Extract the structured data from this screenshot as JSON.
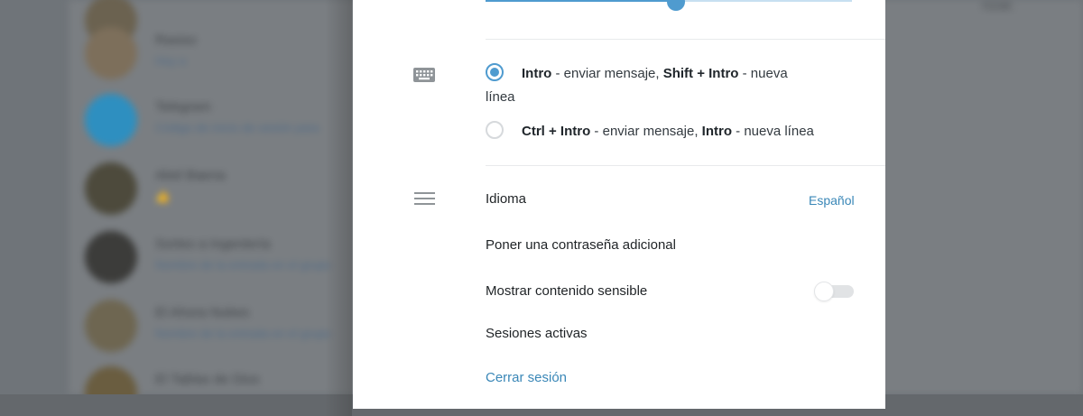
{
  "background": {
    "chats": [
      {
        "name": "Rasiso",
        "preview": "Hoy a"
      },
      {
        "name": "Telegram",
        "preview": "Código de inicio de sesión para"
      },
      {
        "name": "Abel Baena",
        "preview": "👍"
      },
      {
        "name": "Sorteo a Ingeniería",
        "preview": "Nombre de la entrada en el grupo"
      },
      {
        "name": "El Ahora Nubes",
        "preview": "Nombre de la entrada en el grupo"
      },
      {
        "name": "El Tablas de Dios",
        "preview": ""
      }
    ],
    "right_text": "nzar."
  },
  "send_options": [
    {
      "selected": true,
      "key1": "Intro",
      "text1": " - enviar mensaje, ",
      "key2": "Shift + Intro",
      "text2": " - nueva",
      "text3": "línea"
    },
    {
      "selected": false,
      "key1": "Ctrl + Intro",
      "text1": " - enviar mensaje, ",
      "key2": "Intro",
      "text2": " - nueva línea"
    }
  ],
  "settings": {
    "language_label": "Idioma",
    "language_value": "Español",
    "password_label": "Poner una contraseña adicional",
    "sensitive_label": "Mostrar contenido sensible",
    "sensitive_enabled": false,
    "sessions_label": "Sesiones activas",
    "logout_label": "Cerrar sesión"
  },
  "colors": {
    "accent": "#4f9bcf",
    "link": "#3a87b7",
    "text": "#1f2326"
  },
  "icons": {
    "keyboard": "keyboard-icon",
    "menu": "menu-icon"
  },
  "slider": {
    "value_fraction": 0.52
  }
}
